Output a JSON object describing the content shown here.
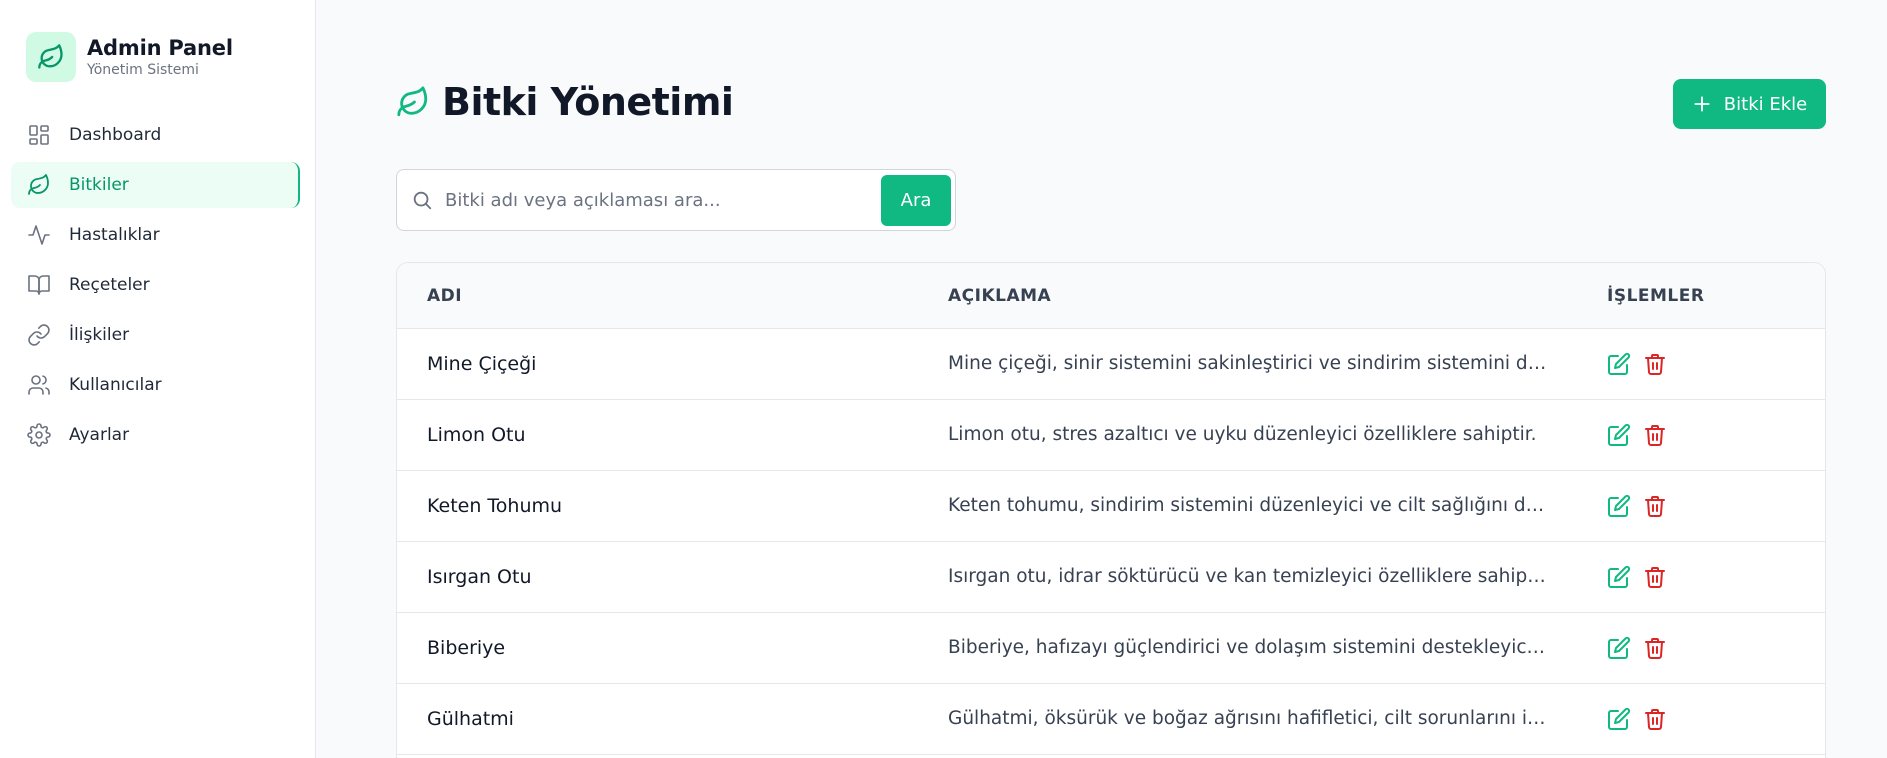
{
  "brand": {
    "title": "Admin Panel",
    "subtitle": "Yönetim Sistemi"
  },
  "nav": {
    "items": [
      {
        "label": "Dashboard",
        "icon": "dashboard-icon"
      },
      {
        "label": "Bitkiler",
        "icon": "leaf-icon",
        "active": true
      },
      {
        "label": "Hastalıklar",
        "icon": "activity-icon"
      },
      {
        "label": "Reçeteler",
        "icon": "book-icon"
      },
      {
        "label": "İlişkiler",
        "icon": "link-icon"
      },
      {
        "label": "Kullanıcılar",
        "icon": "users-icon"
      },
      {
        "label": "Ayarlar",
        "icon": "gear-icon"
      }
    ]
  },
  "page": {
    "title": "Bitki Yönetimi",
    "add_button": "Bitki Ekle"
  },
  "search": {
    "placeholder": "Bitki adı veya açıklaması ara...",
    "value": "",
    "button": "Ara"
  },
  "table": {
    "headers": [
      "ADI",
      "AÇIKLAMA",
      "İŞLEMLER"
    ],
    "rows": [
      {
        "name": "Mine Çiçeği",
        "description": "Mine çiçeği, sinir sistemini sakinleştirici ve sindirim sistemini destekleyici özelliklere sahiptir."
      },
      {
        "name": "Limon Otu",
        "description": "Limon otu, stres azaltıcı ve uyku düzenleyici özelliklere sahiptir."
      },
      {
        "name": "Keten Tohumu",
        "description": "Keten tohumu, sindirim sistemini düzenleyici ve cilt sağlığını destekleyici özelliklere sahiptir."
      },
      {
        "name": "Isırgan Otu",
        "description": "Isırgan otu, idrar söktürücü ve kan temizleyici özelliklere sahiptir."
      },
      {
        "name": "Biberiye",
        "description": "Biberiye, hafızayı güçlendirici ve dolaşım sistemini destekleyici özelliklere sahiptir."
      },
      {
        "name": "Gülhatmi",
        "description": "Gülhatmi, öksürük ve boğaz ağrısını hafifletici, cilt sorunlarını iyileştirici özelliklere sahiptir."
      }
    ]
  },
  "colors": {
    "accent": "#10b981",
    "accent_dark": "#059669",
    "danger": "#dc2626",
    "active_bg": "#ecfdf5"
  }
}
